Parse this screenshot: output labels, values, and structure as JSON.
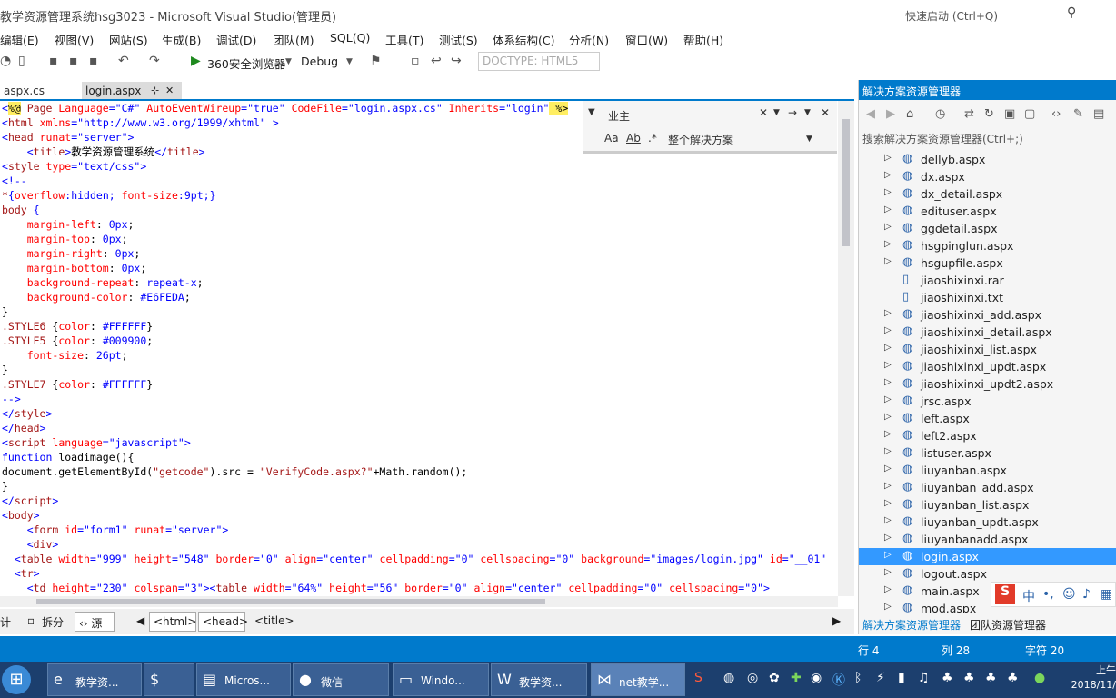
{
  "window": {
    "title": "教学资源管理系统hsg3023 - Microsoft Visual Studio(管理员)",
    "quick_launch": "快速启动 (Ctrl+Q)"
  },
  "menu": [
    "编辑(E)",
    "视图(V)",
    "网站(S)",
    "生成(B)",
    "调试(D)",
    "团队(M)",
    "SQL(Q)",
    "工具(T)",
    "测试(S)",
    "体系结构(C)",
    "分析(N)",
    "窗口(W)",
    "帮助(H)"
  ],
  "toolbar": {
    "run_target": "360安全浏览器",
    "config": "Debug",
    "doctype": "DOCTYPE:  HTML5"
  },
  "tabs": {
    "cs": "aspx.cs",
    "login": "login.aspx",
    "pin": "⊹",
    "close": "✕"
  },
  "find": {
    "query": "业主",
    "scope": "整个解决方案",
    "opt_case": "Aa",
    "opt_word": "Ab",
    "opt_regex": ".*"
  },
  "code": [
    [
      [
        "k",
        "<"
      ],
      [
        "hl",
        "%@"
      ],
      [
        "t",
        " Page "
      ],
      [
        "a",
        "Language"
      ],
      [
        "k",
        "="
      ],
      [
        "v",
        "\"C#\""
      ],
      [
        "a",
        " AutoEventWireup"
      ],
      [
        "k",
        "="
      ],
      [
        "v",
        "\"true\""
      ],
      [
        "a",
        " CodeFile"
      ],
      [
        "k",
        "="
      ],
      [
        "v",
        "\"login.aspx.cs\""
      ],
      [
        "a",
        " Inherits"
      ],
      [
        "k",
        "="
      ],
      [
        "v",
        "\"login\""
      ],
      [
        "hl",
        " %>"
      ]
    ],
    [
      [
        "k",
        "<"
      ],
      [
        "t",
        "html"
      ],
      [
        "a",
        " xmlns"
      ],
      [
        "k",
        "="
      ],
      [
        "v",
        "\"http://www.w3.org/1999/xhtml\""
      ],
      [
        "k",
        " >"
      ]
    ],
    [
      [
        "k",
        "<"
      ],
      [
        "t",
        "head"
      ],
      [
        "a",
        " runat"
      ],
      [
        "k",
        "="
      ],
      [
        "v",
        "\"server\""
      ],
      [
        "k",
        ">"
      ]
    ],
    [
      [
        "",
        ""
      ],
      [
        "k",
        "    <"
      ],
      [
        "t",
        "title"
      ],
      [
        "k",
        ">"
      ],
      [
        "",
        "教学资源管理系统"
      ],
      [
        "k",
        "</"
      ],
      [
        "t",
        "title"
      ],
      [
        "k",
        ">"
      ]
    ],
    [
      [
        "k",
        "<"
      ],
      [
        "t",
        "style"
      ],
      [
        "a",
        " type"
      ],
      [
        "k",
        "="
      ],
      [
        "v",
        "\"text/css\""
      ],
      [
        "k",
        ">"
      ]
    ],
    [
      [
        "k",
        "<!--"
      ]
    ],
    [
      [
        "t",
        "*"
      ],
      [
        "k",
        "{"
      ],
      [
        "a",
        "overflow"
      ],
      [
        "k",
        ":"
      ],
      [
        "v",
        "hidden"
      ],
      [
        "k",
        "; "
      ],
      [
        "a",
        "font-size"
      ],
      [
        "k",
        ":"
      ],
      [
        "v",
        "9pt"
      ],
      [
        "k",
        ";}"
      ]
    ],
    [
      [
        "t",
        "body"
      ],
      [
        "k",
        " {"
      ]
    ],
    [
      [
        "a",
        "    margin-left"
      ],
      [
        "",
        ": "
      ],
      [
        "v",
        "0px"
      ],
      [
        "",
        ";"
      ]
    ],
    [
      [
        "a",
        "    margin-top"
      ],
      [
        "",
        ": "
      ],
      [
        "v",
        "0px"
      ],
      [
        "",
        ";"
      ]
    ],
    [
      [
        "a",
        "    margin-right"
      ],
      [
        "",
        ": "
      ],
      [
        "v",
        "0px"
      ],
      [
        "",
        ";"
      ]
    ],
    [
      [
        "a",
        "    margin-bottom"
      ],
      [
        "",
        ": "
      ],
      [
        "v",
        "0px"
      ],
      [
        "",
        ";"
      ]
    ],
    [
      [
        "a",
        "    background-repeat"
      ],
      [
        "",
        ": "
      ],
      [
        "v",
        "repeat-x"
      ],
      [
        "",
        ";"
      ]
    ],
    [
      [
        "a",
        "    background-color"
      ],
      [
        "",
        ": "
      ],
      [
        "v",
        "#E6FEDA"
      ],
      [
        "",
        ";"
      ]
    ],
    [
      [
        "",
        "}"
      ]
    ],
    [
      [
        "t",
        ".STYLE6"
      ],
      [
        "",
        " {"
      ],
      [
        "a",
        "color"
      ],
      [
        "",
        ": "
      ],
      [
        "v",
        "#FFFFFF"
      ],
      [
        "",
        "}"
      ]
    ],
    [
      [
        "t",
        ".STYLE5"
      ],
      [
        "",
        " {"
      ],
      [
        "a",
        "color"
      ],
      [
        "",
        ": "
      ],
      [
        "v",
        "#009900"
      ],
      [
        "",
        ";"
      ]
    ],
    [
      [
        "a",
        "    font-size"
      ],
      [
        "",
        ": "
      ],
      [
        "v",
        "26pt"
      ],
      [
        "",
        ";"
      ]
    ],
    [
      [
        "",
        "}"
      ]
    ],
    [
      [
        "t",
        ".STYLE7"
      ],
      [
        "",
        " {"
      ],
      [
        "a",
        "color"
      ],
      [
        "",
        ": "
      ],
      [
        "v",
        "#FFFFFF"
      ],
      [
        "",
        "}"
      ]
    ],
    [
      [
        "k",
        "-->"
      ]
    ],
    [
      [
        "k",
        "</"
      ],
      [
        "t",
        "style"
      ],
      [
        "k",
        ">"
      ]
    ],
    [
      [
        "k",
        "</"
      ],
      [
        "t",
        "head"
      ],
      [
        "k",
        ">"
      ]
    ],
    [
      [
        "k",
        "<"
      ],
      [
        "t",
        "script"
      ],
      [
        "a",
        " language"
      ],
      [
        "k",
        "="
      ],
      [
        "v",
        "\"javascript\""
      ],
      [
        "k",
        ">"
      ]
    ],
    [
      [
        "k",
        "function"
      ],
      [
        "",
        " loadimage(){"
      ]
    ],
    [
      [
        "",
        "document.getElementById("
      ],
      [
        "t",
        "\"getcode\""
      ],
      [
        "",
        ").src = "
      ],
      [
        "t",
        "\"VerifyCode.aspx?\""
      ],
      [
        "",
        "+Math.random();"
      ]
    ],
    [
      [
        "",
        "}"
      ]
    ],
    [
      [
        "k",
        "</"
      ],
      [
        "t",
        "script"
      ],
      [
        "k",
        ">"
      ]
    ],
    [
      [
        "k",
        "<"
      ],
      [
        "t",
        "body"
      ],
      [
        "k",
        ">"
      ]
    ],
    [
      [
        "k",
        "    <"
      ],
      [
        "t",
        "form"
      ],
      [
        "a",
        " id"
      ],
      [
        "k",
        "="
      ],
      [
        "v",
        "\"form1\""
      ],
      [
        "a",
        " runat"
      ],
      [
        "k",
        "="
      ],
      [
        "v",
        "\"server\""
      ],
      [
        "k",
        ">"
      ]
    ],
    [
      [
        "k",
        "    <"
      ],
      [
        "t",
        "div"
      ],
      [
        "k",
        ">"
      ]
    ],
    [
      [
        "k",
        "  <"
      ],
      [
        "t",
        "table"
      ],
      [
        "a",
        " width"
      ],
      [
        "k",
        "="
      ],
      [
        "v",
        "\"999\""
      ],
      [
        "a",
        " height"
      ],
      [
        "k",
        "="
      ],
      [
        "v",
        "\"548\""
      ],
      [
        "a",
        " border"
      ],
      [
        "k",
        "="
      ],
      [
        "v",
        "\"0\""
      ],
      [
        "a",
        " align"
      ],
      [
        "k",
        "="
      ],
      [
        "v",
        "\"center\""
      ],
      [
        "a",
        " cellpadding"
      ],
      [
        "k",
        "="
      ],
      [
        "v",
        "\"0\""
      ],
      [
        "a",
        " cellspacing"
      ],
      [
        "k",
        "="
      ],
      [
        "v",
        "\"0\""
      ],
      [
        "a",
        " background"
      ],
      [
        "k",
        "="
      ],
      [
        "v",
        "\"images/login.jpg\""
      ],
      [
        "a",
        " id"
      ],
      [
        "k",
        "="
      ],
      [
        "v",
        "\"__01\""
      ]
    ],
    [
      [
        "k",
        "  <"
      ],
      [
        "t",
        "tr"
      ],
      [
        "k",
        ">"
      ]
    ],
    [
      [
        "k",
        "    <"
      ],
      [
        "t",
        "td"
      ],
      [
        "a",
        " height"
      ],
      [
        "k",
        "="
      ],
      [
        "v",
        "\"230\""
      ],
      [
        "a",
        " colspan"
      ],
      [
        "k",
        "="
      ],
      [
        "v",
        "\"3\""
      ],
      [
        "k",
        "><"
      ],
      [
        "t",
        "table"
      ],
      [
        "a",
        " width"
      ],
      [
        "k",
        "="
      ],
      [
        "v",
        "\"64%\""
      ],
      [
        "a",
        " height"
      ],
      [
        "k",
        "="
      ],
      [
        "v",
        "\"56\""
      ],
      [
        "a",
        " border"
      ],
      [
        "k",
        "="
      ],
      [
        "v",
        "\"0\""
      ],
      [
        "a",
        " align"
      ],
      [
        "k",
        "="
      ],
      [
        "v",
        "\"center\""
      ],
      [
        "a",
        " cellpadding"
      ],
      [
        "k",
        "="
      ],
      [
        "v",
        "\"0\""
      ],
      [
        "a",
        " cellspacing"
      ],
      [
        "k",
        "="
      ],
      [
        "v",
        "\"0\""
      ],
      [
        "k",
        ">"
      ]
    ]
  ],
  "editor_bar": {
    "design": "计",
    "split": "拆分",
    "source": "‹› 源",
    "crumbs": [
      "<html>",
      "<head>",
      "<title>"
    ]
  },
  "solution_explorer": {
    "header": "解决方案资源管理器",
    "search": "搜索解决方案资源管理器(Ctrl+;)",
    "items": [
      {
        "label": "dellyb.aspx",
        "expandable": true,
        "selected": false
      },
      {
        "label": "dx.aspx",
        "expandable": true,
        "selected": false
      },
      {
        "label": "dx_detail.aspx",
        "expandable": true,
        "selected": false
      },
      {
        "label": "edituser.aspx",
        "expandable": true,
        "selected": false
      },
      {
        "label": "ggdetail.aspx",
        "expandable": true,
        "selected": false
      },
      {
        "label": "hsgpinglun.aspx",
        "expandable": true,
        "selected": false
      },
      {
        "label": "hsgupfile.aspx",
        "expandable": true,
        "selected": false
      },
      {
        "label": "jiaoshixinxi.rar",
        "expandable": false,
        "selected": false
      },
      {
        "label": "jiaoshixinxi.txt",
        "expandable": false,
        "selected": false
      },
      {
        "label": "jiaoshixinxi_add.aspx",
        "expandable": true,
        "selected": false
      },
      {
        "label": "jiaoshixinxi_detail.aspx",
        "expandable": true,
        "selected": false
      },
      {
        "label": "jiaoshixinxi_list.aspx",
        "expandable": true,
        "selected": false
      },
      {
        "label": "jiaoshixinxi_updt.aspx",
        "expandable": true,
        "selected": false
      },
      {
        "label": "jiaoshixinxi_updt2.aspx",
        "expandable": true,
        "selected": false
      },
      {
        "label": "jrsc.aspx",
        "expandable": true,
        "selected": false
      },
      {
        "label": "left.aspx",
        "expandable": true,
        "selected": false
      },
      {
        "label": "left2.aspx",
        "expandable": true,
        "selected": false
      },
      {
        "label": "listuser.aspx",
        "expandable": true,
        "selected": false
      },
      {
        "label": "liuyanban.aspx",
        "expandable": true,
        "selected": false
      },
      {
        "label": "liuyanban_add.aspx",
        "expandable": true,
        "selected": false
      },
      {
        "label": "liuyanban_list.aspx",
        "expandable": true,
        "selected": false
      },
      {
        "label": "liuyanban_updt.aspx",
        "expandable": true,
        "selected": false
      },
      {
        "label": "liuyanbanadd.aspx",
        "expandable": true,
        "selected": false
      },
      {
        "label": "login.aspx",
        "expandable": true,
        "selected": true
      },
      {
        "label": "logout.aspx",
        "expandable": true,
        "selected": false
      },
      {
        "label": "main.aspx",
        "expandable": true,
        "selected": false
      },
      {
        "label": "mod.aspx",
        "expandable": true,
        "selected": false
      }
    ],
    "bottom_tabs": [
      "解决方案资源管理器",
      "团队资源管理器"
    ]
  },
  "ime": {
    "logo": "S",
    "lang": "中"
  },
  "status": {
    "line": "行 4",
    "col": "列 28",
    "char": "字符 20"
  },
  "taskbar": {
    "tasks": [
      {
        "label": "教学资...",
        "icon": "e"
      },
      {
        "label": "",
        "icon": "$"
      },
      {
        "label": "Micros...",
        "icon": "▤"
      },
      {
        "label": "微信",
        "icon": "●"
      },
      {
        "label": "Windo...",
        "icon": "▭"
      },
      {
        "label": "教学资...",
        "icon": "W"
      },
      {
        "label": "net教学...",
        "icon": "⋈"
      }
    ],
    "clock_time": "上午",
    "clock_date": "2018/11/"
  }
}
